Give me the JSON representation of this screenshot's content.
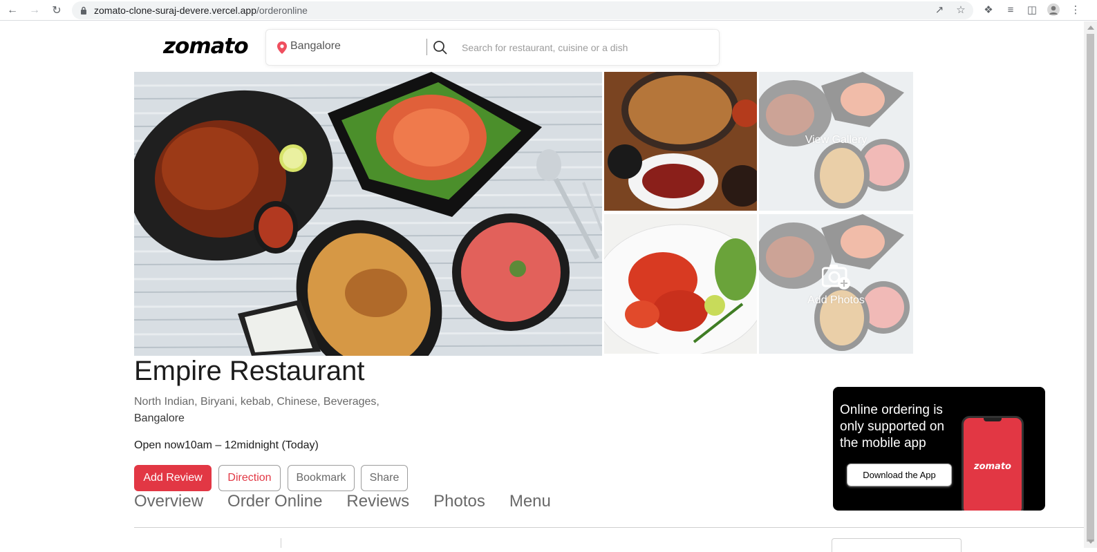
{
  "browser": {
    "url_host": "zomato-clone-suraj-devere.vercel.app",
    "url_path": "/orderonline"
  },
  "header": {
    "logo": "zomato",
    "location": "Bangalore",
    "search_placeholder": "Search for restaurant, cuisine or a dish"
  },
  "gallery": {
    "view_gallery_label": "View Gallery",
    "add_photos_label": "Add Photos"
  },
  "restaurant": {
    "name": "Empire Restaurant",
    "cuisines": "North Indian, Biryani, kebab, Chinese, Beverages,",
    "city": "Bangalore",
    "timing": "Open now10am – 12midnight (Today)"
  },
  "actions": {
    "add_review": "Add Review",
    "direction": "Direction",
    "bookmark": "Bookmark",
    "share": "Share"
  },
  "tabs": [
    "Overview",
    "Order Online",
    "Reviews",
    "Photos",
    "Menu"
  ],
  "promo": {
    "text": "Online ordering is only supported on the mobile app",
    "button": "Download the App",
    "phone_logo": "zomato"
  },
  "colors": {
    "brand": "#e23744",
    "text_dark": "#1c1c1c",
    "text_muted": "#696969"
  }
}
